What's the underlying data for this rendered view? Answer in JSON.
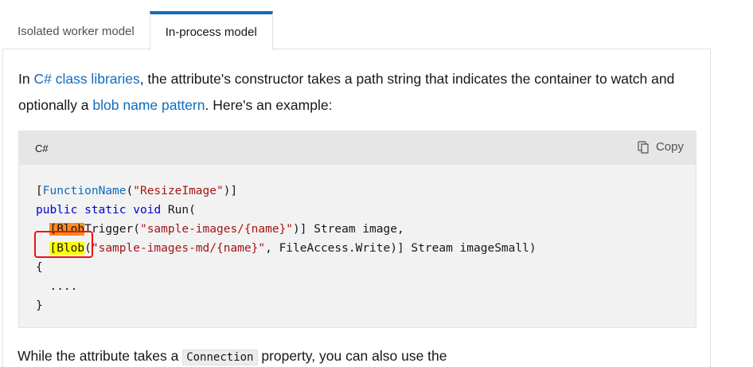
{
  "tabs": [
    {
      "label": "Isolated worker model",
      "active": false
    },
    {
      "label": "In-process model",
      "active": true
    }
  ],
  "intro": {
    "t1": "In ",
    "link1": "C# class libraries",
    "t2": ", the attribute's constructor takes a path string that indicates the container to watch and optionally a ",
    "link2": "blob name pattern",
    "t3": ". Here's an example:"
  },
  "code_block": {
    "language": "C#",
    "copy_label": "Copy",
    "copy_icon": "copy-icon",
    "lines": {
      "l1_open": "[",
      "l1_attr": "FunctionName",
      "l1_p": "(",
      "l1_str": "\"ResizeImage\"",
      "l1_close": ")]",
      "l2_kw1": "public",
      "l2_kw2": "static",
      "l2_kw3": "void",
      "l2_rest": "Run(",
      "l3_hl": "[Blob",
      "l3_mid": "Trigger(",
      "l3_str": "\"sample-images/{name}\"",
      "l3_rest": ")] Stream image,",
      "l4_hl": "[Blob",
      "l4_p": "(",
      "l4_str": "\"sample-images-md/{name}\"",
      "l4_rest": ", FileAccess.Write)] Stream imageSmall)",
      "l5": "{",
      "l6": "....",
      "l7": "}"
    }
  },
  "next": {
    "t1": "While the attribute takes a ",
    "code": "Connection",
    "t2": " property, you can also use the"
  },
  "colors": {
    "accent": "#0f6cbd",
    "highlight_orange": "#ff8a1f",
    "highlight_yellow": "#ffff00",
    "annotation_red": "#ee1111"
  }
}
